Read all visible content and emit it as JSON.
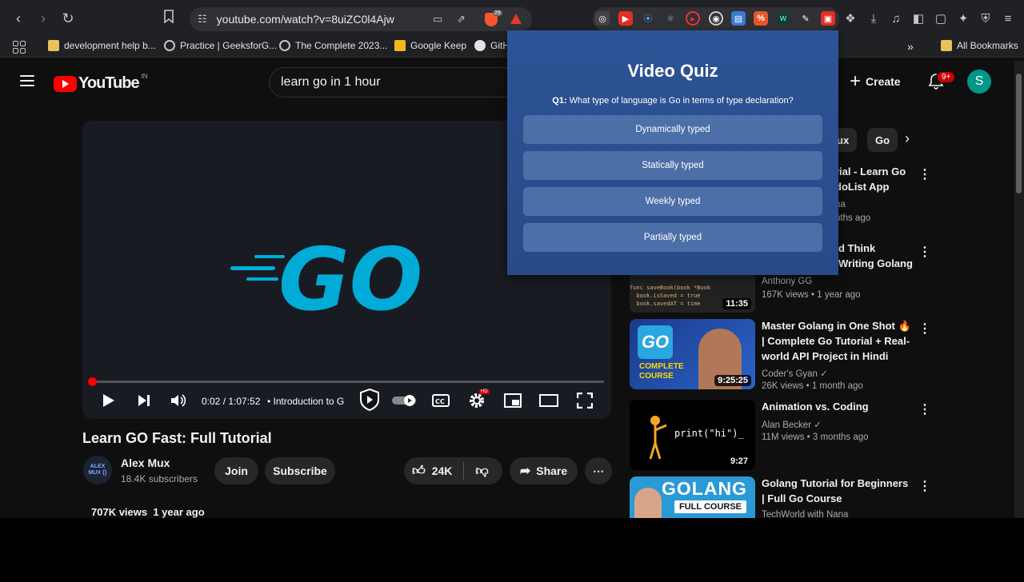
{
  "browser": {
    "url": "youtube.com/watch?v=8uiZC0l4Ajw",
    "brave_badge": "29",
    "bookmarks": [
      {
        "label": "development help b...",
        "icon": "folder-icon"
      },
      {
        "label": "Practice | GeeksforG...",
        "icon": "globe-icon"
      },
      {
        "label": "The Complete 2023...",
        "icon": "globe-icon"
      },
      {
        "label": "Google Keep",
        "icon": "keep-icon"
      },
      {
        "label": "GitH",
        "icon": "github-icon"
      }
    ],
    "all_bookmarks": "All Bookmarks",
    "overflow": "»"
  },
  "youtube": {
    "logo_text": "YouTube",
    "country": "IN",
    "search_query": "learn go in 1 hour",
    "create_label": "Create",
    "notification_count": "9+",
    "avatar_initial": "S"
  },
  "player": {
    "time": "0:02 / 1:07:52",
    "chapter": "• Introduction to G",
    "logo_text": "GO",
    "progress": 0.0005
  },
  "video": {
    "title": "Learn GO Fast: Full Tutorial",
    "channel": "Alex Mux",
    "channel_avatar_text": "ALEX MUX {}",
    "subscribers": "18.4K subscribers",
    "join_label": "Join",
    "subscribe_label": "Subscribe",
    "likes": "24K",
    "share_label": "Share",
    "views": "707K views",
    "age": "1 year ago"
  },
  "chips": [
    "ux",
    "Go"
  ],
  "recommendations_partial": {
    "r1_title_a": "rial - Learn Go",
    "r1_title_b": "doList App",
    "r1_channel": "na",
    "r1_meta": "nths ago",
    "r2_title_a": "d Think",
    "r2_title_b": "Writing Golang"
  },
  "recommendations": [
    {
      "title": "",
      "channel": "Anthony GG",
      "meta": "167K views  • 1 year ago",
      "duration": "11:35",
      "code": [
        "func saveBook(book *Book",
        "  book.isSaved = true",
        "  book.savedAT = time"
      ]
    },
    {
      "title": "Master Golang in One Shot 🔥 | Complete Go Tutorial + Real-world API Project in Hindi",
      "channel": "Coder's Gyan ✓",
      "meta": "26K views  • 1 month ago",
      "duration": "9:25:25",
      "thumb_go": "GO",
      "thumb_text": "COMPLETE COURSE"
    },
    {
      "title": "Animation vs. Coding",
      "channel": "Alan Becker ✓",
      "meta": "11M views  • 3 months ago",
      "duration": "9:27",
      "thumb_text": "print(\"hi\")_"
    },
    {
      "title": "Golang Tutorial for Beginners | Full Go Course",
      "channel": "TechWorld with Nana",
      "meta": "",
      "duration": "",
      "thumb_title": "GOLANG",
      "thumb_sub": "FULL COURSE"
    }
  ],
  "quiz": {
    "title": "Video Quiz",
    "question_label": "Q1:",
    "question": "What type of language is Go in terms of type declaration?",
    "options": [
      "Dynamically typed",
      "Statically typed",
      "Weekly typed",
      "Partially typed"
    ]
  },
  "colors": {
    "yt_red": "#ff0000",
    "go_blue": "#00acd7",
    "quiz_bg": "#2d5496",
    "quiz_option": "#4d6fa8"
  }
}
